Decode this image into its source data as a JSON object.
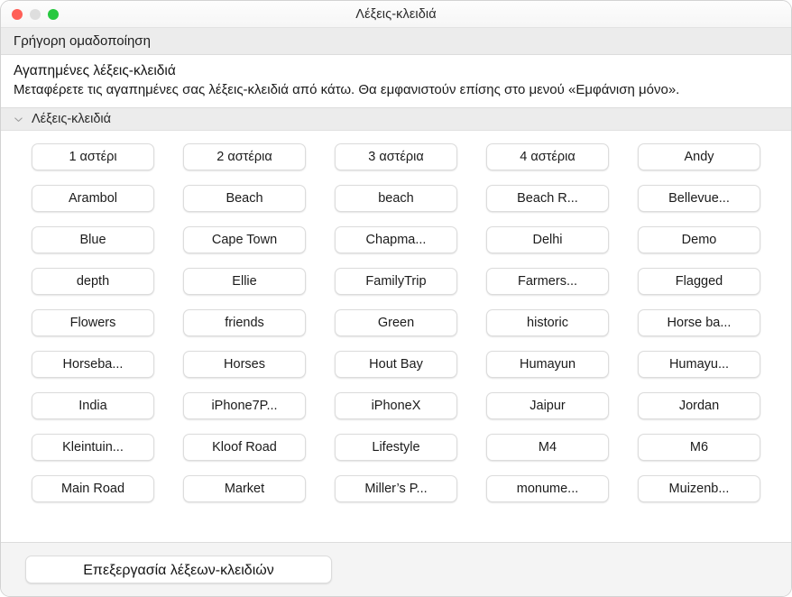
{
  "window": {
    "title": "Λέξεις-κλειδιά",
    "traffic_lights": {
      "close": "close-button",
      "minimize": "minimize-button",
      "zoom": "zoom-button",
      "close_color": "#ff5f57",
      "minimize_color": "#dedede",
      "zoom_color": "#28c840"
    }
  },
  "toolbar": {
    "quick_group_label": "Γρήγορη ομαδοποίηση"
  },
  "description": {
    "heading": "Αγαπημένες λέξεις-κλειδιά",
    "body": "Μεταφέρετε τις αγαπημένες σας λέξεις-κλειδιά από κάτω. Θα εμφανιστούν επίσης στο μενού «Εμφάνιση μόνο»."
  },
  "section": {
    "label": "Λέξεις-κλειδιά",
    "disclosure_icon": "chevron-down-icon",
    "expanded": true
  },
  "keywords": [
    "1 αστέρι",
    "2 αστέρια",
    "3 αστέρια",
    "4 αστέρια",
    "Andy",
    "Arambol",
    "Beach",
    "beach",
    "Beach R...",
    "Bellevue...",
    "Blue",
    "Cape Town",
    "Chapma...",
    "Delhi",
    "Demo",
    "depth",
    "Ellie",
    "FamilyTrip",
    "Farmers...",
    "Flagged",
    "Flowers",
    "friends",
    "Green",
    "historic",
    "Horse ba...",
    "Horseba...",
    "Horses",
    "Hout Bay",
    "Humayun",
    "Humayu...",
    "India",
    "iPhone7P...",
    "iPhoneX",
    "Jaipur",
    "Jordan",
    "Kleintuin...",
    "Kloof Road",
    "Lifestyle",
    "M4",
    "M6",
    "Main Road",
    "Market",
    "Miller’s P...",
    "monume...",
    "Muizenb..."
  ],
  "bottom_bar": {
    "edit_keywords_label": "Επεξεργασία λέξεων-κλειδιών"
  }
}
